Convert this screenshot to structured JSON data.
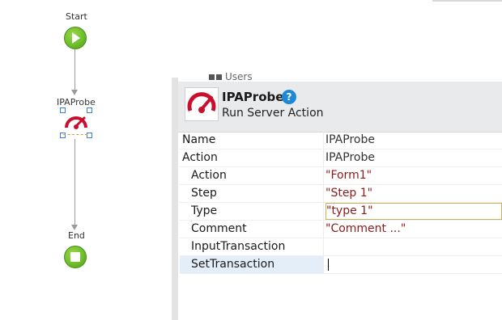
{
  "flow": {
    "start_label": "Start",
    "probe_label": "IPAProbe",
    "end_label": "End"
  },
  "background_panel": {
    "partial_item": "Users"
  },
  "properties": {
    "title": "IPAProbe",
    "subtitle": "Run Server Action",
    "help_symbol": "?",
    "rows": [
      {
        "name": "Name",
        "value": "IPAProbe",
        "kind": "plain",
        "indent": false
      },
      {
        "name": "Action",
        "value": "IPAProbe",
        "kind": "plain",
        "indent": false
      },
      {
        "name": "Action",
        "value": "\"Form1\"",
        "kind": "string",
        "indent": true
      },
      {
        "name": "Step",
        "value": "\"Step 1\"",
        "kind": "string",
        "indent": true
      },
      {
        "name": "Type",
        "value": "\"type 1\"",
        "kind": "string",
        "indent": true,
        "focused": true
      },
      {
        "name": "Comment",
        "value": "\"Comment ...\"",
        "kind": "string",
        "indent": true
      },
      {
        "name": "InputTransaction",
        "value": "",
        "kind": "plain",
        "indent": true
      },
      {
        "name": "SetTransaction",
        "value": "",
        "kind": "plain",
        "indent": true,
        "selected": true,
        "editing": true
      }
    ]
  },
  "colors": {
    "node_green": "#6fbe2a",
    "help_blue": "#1e88d8",
    "string_value": "#8b1a1a",
    "probe_red": "#c8102e"
  }
}
